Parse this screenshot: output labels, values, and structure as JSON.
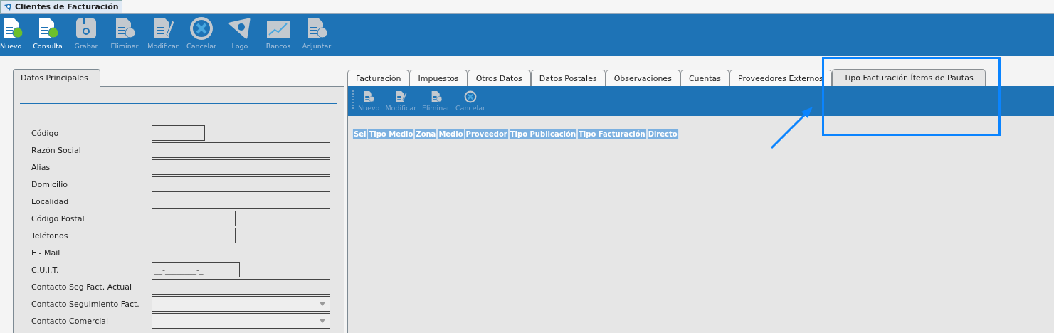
{
  "window": {
    "title": "Clientes de Facturación"
  },
  "toolbar": [
    {
      "label": "Nuevo",
      "kind": "new",
      "disabled": false
    },
    {
      "label": "Consulta",
      "kind": "query",
      "disabled": false
    },
    {
      "label": "Grabar",
      "kind": "save",
      "disabled": true
    },
    {
      "label": "Eliminar",
      "kind": "delete",
      "disabled": true
    },
    {
      "label": "Modificar",
      "kind": "edit",
      "disabled": true
    },
    {
      "label": "Cancelar",
      "kind": "cancel",
      "disabled": true
    },
    {
      "label": "Logo",
      "kind": "logo",
      "disabled": true
    },
    {
      "label": "Bancos",
      "kind": "chart",
      "disabled": true
    },
    {
      "label": "Adjuntar",
      "kind": "attach",
      "disabled": true
    }
  ],
  "main_panel": {
    "tab": "Datos Principales",
    "fields": [
      {
        "label": "Código",
        "kind": "code"
      },
      {
        "label": "Razón Social",
        "kind": "long"
      },
      {
        "label": "Alias",
        "kind": "long"
      },
      {
        "label": "Domicilio",
        "kind": "long"
      },
      {
        "label": "Localidad",
        "kind": "long"
      },
      {
        "label": "Código Postal",
        "kind": "short"
      },
      {
        "label": "Teléfonos",
        "kind": "short"
      },
      {
        "label": "E - Mail",
        "kind": "long"
      },
      {
        "label": "C.U.I.T.",
        "kind": "masked",
        "placeholder": "__-________-_"
      },
      {
        "label": "Contacto Seg Fact. Actual",
        "kind": "long"
      },
      {
        "label": "Contacto Seguimiento Fact.",
        "kind": "combo"
      },
      {
        "label": "Contacto Comercial",
        "kind": "combo"
      }
    ]
  },
  "tabs": [
    {
      "label": "Facturación",
      "selected": false
    },
    {
      "label": "Impuestos",
      "selected": false
    },
    {
      "label": "Otros Datos",
      "selected": false
    },
    {
      "label": "Datos Postales",
      "selected": false
    },
    {
      "label": "Observaciones",
      "selected": false
    },
    {
      "label": "Cuentas",
      "selected": false
    },
    {
      "label": "Proveedores Externos",
      "selected": false
    },
    {
      "label": "Tipo Facturación Ítems de Pautas",
      "selected": true
    }
  ],
  "sub_toolbar": [
    {
      "label": "Nuevo",
      "kind": "new",
      "disabled": true
    },
    {
      "label": "Modificar",
      "kind": "edit",
      "disabled": true
    },
    {
      "label": "Eliminar",
      "kind": "delete",
      "disabled": true
    },
    {
      "label": "Cancelar",
      "kind": "cancel",
      "disabled": true
    }
  ],
  "table": {
    "columns": [
      "Sel",
      "Tipo Medio",
      "Zona",
      "Medio",
      "Proveedor",
      "Tipo Publicación",
      "Tipo Facturación",
      "Directo"
    ]
  }
}
